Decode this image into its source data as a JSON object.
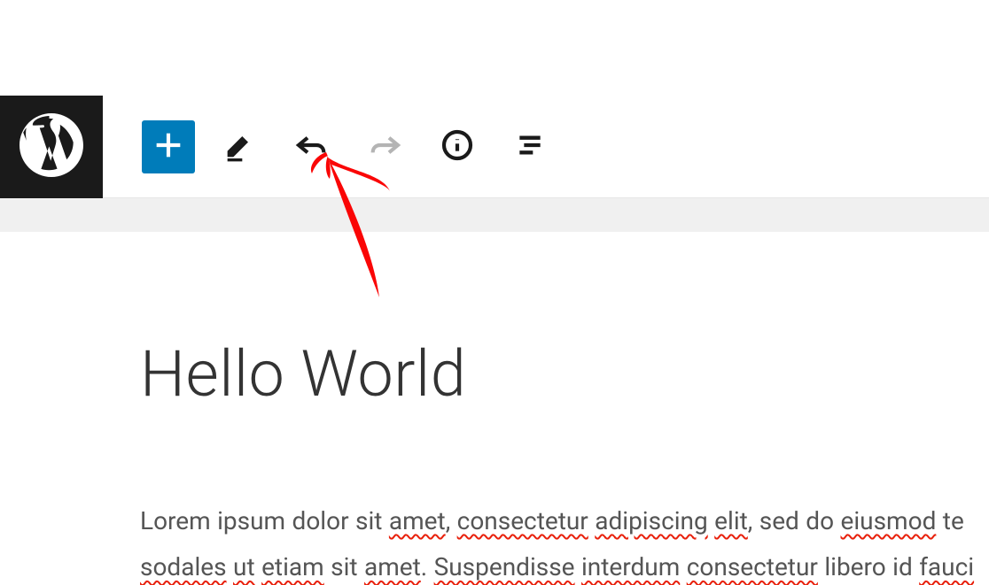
{
  "toolbar": {
    "add_label": "Add block",
    "tools_label": "Tools",
    "undo_label": "Undo",
    "redo_label": "Redo",
    "info_label": "Details",
    "outline_label": "Outline"
  },
  "post": {
    "title": "Hello World",
    "body_line1_pre": "Lorem ipsum dolor sit ",
    "w1": "amet",
    "body_line1_mid1": ", ",
    "w2": "consectetur",
    "body_line1_mid2": " ",
    "w3": "adipiscing",
    "body_line1_mid3": " ",
    "w4": "elit",
    "body_line1_mid4": ", sed do ",
    "w5": "eiusmod",
    "body_line1_post": " te",
    "w6": "sodales",
    "body_line2_mid1": " ",
    "w7": "ut",
    "body_line2_mid2": " ",
    "w8": "etiam",
    "body_line2_mid3": " sit ",
    "w9": "amet",
    "body_line2_mid4": ". ",
    "w10": "Suspendisse",
    "body_line2_mid5": " ",
    "w11": "interdum",
    "body_line2_mid6": " ",
    "w12": "consectetur",
    "body_line2_mid7": " libero id ",
    "w13": "fauci"
  },
  "colors": {
    "accent": "#007cba",
    "logo_bg": "#1a1a1a",
    "annotation": "#fa0606"
  }
}
